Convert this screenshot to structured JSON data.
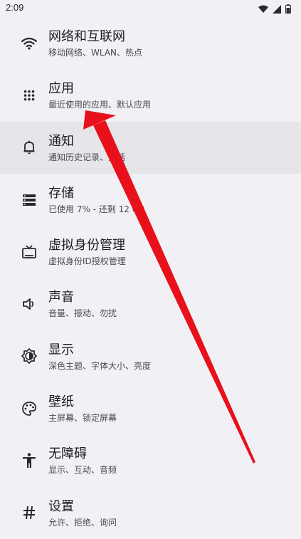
{
  "status_bar": {
    "time": "2:09"
  },
  "settings": {
    "items": [
      {
        "id": "network",
        "title": "网络和互联网",
        "subtitle": "移动网络、WLAN、热点",
        "icon": "wifi-icon"
      },
      {
        "id": "apps",
        "title": "应用",
        "subtitle": "最近使用的应用、默认应用",
        "icon": "apps-grid-icon"
      },
      {
        "id": "notifications",
        "title": "通知",
        "subtitle": "通知历史记录、对话",
        "icon": "bell-icon"
      },
      {
        "id": "storage",
        "title": "存储",
        "subtitle": "已使用 7% - 还剩 12 GB",
        "icon": "storage-icon"
      },
      {
        "id": "virtual-identity",
        "title": "虚拟身份管理",
        "subtitle": "虚拟身份ID授权管理",
        "icon": "tv-icon"
      },
      {
        "id": "sound",
        "title": "声音",
        "subtitle": "音量、振动、勿扰",
        "icon": "speaker-icon"
      },
      {
        "id": "display",
        "title": "显示",
        "subtitle": "深色主题、字体大小、亮度",
        "icon": "brightness-icon"
      },
      {
        "id": "wallpaper",
        "title": "壁纸",
        "subtitle": "主屏幕、锁定屏幕",
        "icon": "palette-icon"
      },
      {
        "id": "accessibility",
        "title": "无障碍",
        "subtitle": "显示、互动、音频",
        "icon": "accessibility-icon"
      },
      {
        "id": "settings",
        "title": "设置",
        "subtitle": "允许、拒绝、询问",
        "icon": "hash-icon"
      }
    ]
  },
  "colors": {
    "background": "#f1f0f5",
    "highlight": "#e6e5ea",
    "arrow": "#e8101a"
  }
}
